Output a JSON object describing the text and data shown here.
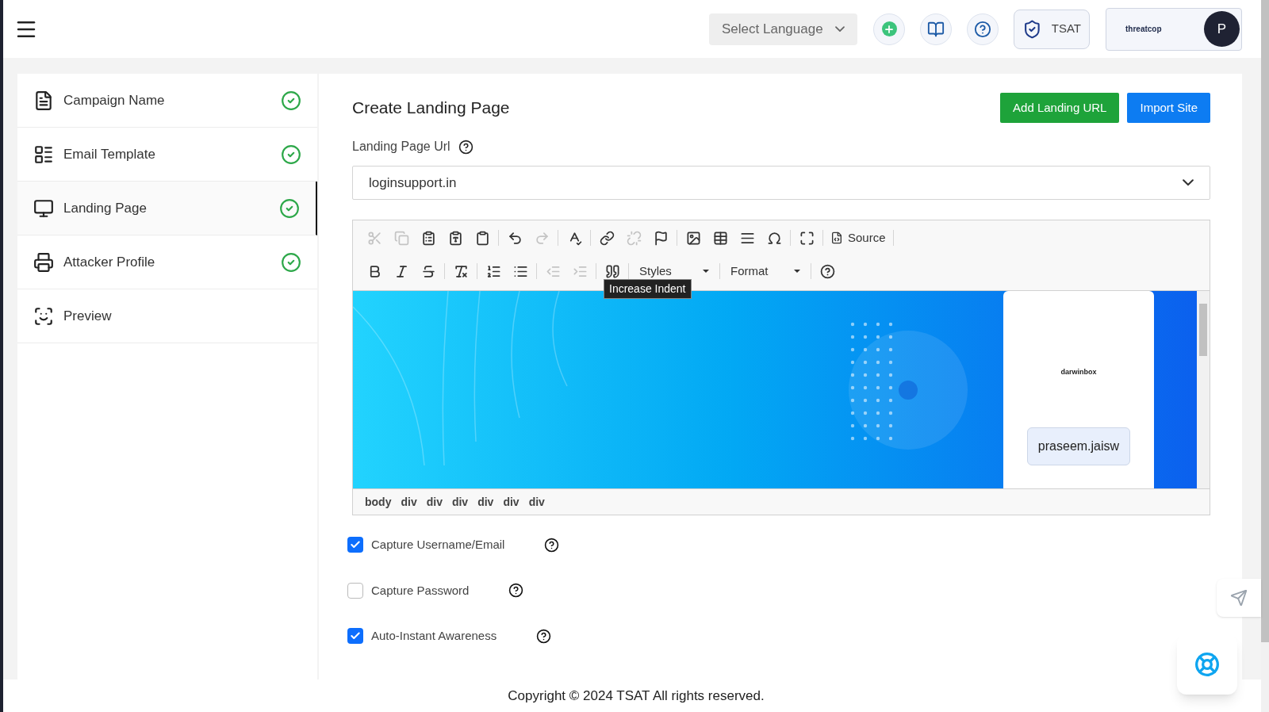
{
  "header": {
    "language_select": {
      "placeholder": "Select Language"
    },
    "brand": "TSAT",
    "org_logo": "threatcop",
    "avatar": "P"
  },
  "sidebar": {
    "items": [
      {
        "label": "Campaign Name",
        "kind": "document",
        "done": true,
        "selected": false
      },
      {
        "label": "Email Template",
        "kind": "template",
        "done": true,
        "selected": false
      },
      {
        "label": "Landing Page",
        "kind": "screen",
        "done": true,
        "selected": true
      },
      {
        "label": "Attacker Profile",
        "kind": "printer",
        "done": true,
        "selected": false
      },
      {
        "label": "Preview",
        "kind": "scan",
        "done": false,
        "selected": false
      }
    ]
  },
  "main": {
    "title": "Create Landing Page",
    "buttons": [
      {
        "label": "Add Landing URL",
        "kind": "green"
      },
      {
        "label": "Import Site",
        "kind": "blue"
      }
    ],
    "url_label": "Landing Page Url",
    "url_value": "loginsupport.in",
    "editor": {
      "toolbar_rows": [
        [
          {
            "kind": "cut",
            "disabled": true
          },
          {
            "kind": "copy",
            "disabled": true
          },
          {
            "kind": "paste",
            "disabled": false
          },
          {
            "kind": "paste-text",
            "disabled": false
          },
          {
            "kind": "paste-word",
            "disabled": false
          },
          {
            "kind": "sep"
          },
          {
            "kind": "undo",
            "disabled": false
          },
          {
            "kind": "redo",
            "disabled": true
          },
          {
            "kind": "sep"
          },
          {
            "kind": "spellcheck",
            "disabled": false
          },
          {
            "kind": "sep"
          },
          {
            "kind": "link",
            "disabled": false
          },
          {
            "kind": "unlink",
            "disabled": true
          },
          {
            "kind": "anchor",
            "disabled": false
          },
          {
            "kind": "sep"
          },
          {
            "kind": "image",
            "disabled": false
          },
          {
            "kind": "table",
            "disabled": false
          },
          {
            "kind": "hr",
            "disabled": false
          },
          {
            "kind": "special-char",
            "disabled": false
          },
          {
            "kind": "sep"
          },
          {
            "kind": "maximize",
            "disabled": false
          },
          {
            "kind": "sep"
          },
          {
            "kind": "source",
            "label": "Source",
            "disabled": false
          },
          {
            "kind": "sep"
          }
        ],
        [
          {
            "kind": "bold",
            "disabled": false
          },
          {
            "kind": "italic",
            "disabled": false
          },
          {
            "kind": "strike",
            "disabled": false
          },
          {
            "kind": "sep"
          },
          {
            "kind": "remove-format",
            "disabled": false
          },
          {
            "kind": "sep"
          },
          {
            "kind": "numbered-list",
            "disabled": false
          },
          {
            "kind": "bulleted-list",
            "disabled": false
          },
          {
            "kind": "sep"
          },
          {
            "kind": "outdent",
            "disabled": true
          },
          {
            "kind": "indent",
            "disabled": true
          },
          {
            "kind": "sep"
          },
          {
            "kind": "blockquote",
            "disabled": false
          },
          {
            "kind": "sep"
          },
          {
            "kind": "dropdown",
            "label": "Styles",
            "disabled": false
          },
          {
            "kind": "sep"
          },
          {
            "kind": "dropdown",
            "label": "Format",
            "disabled": false
          },
          {
            "kind": "sep"
          },
          {
            "kind": "help",
            "disabled": false
          }
        ]
      ],
      "tooltip": "Increase Indent",
      "preview": {
        "logo": "darwinbox",
        "username": "praseem.jaisw"
      },
      "path": [
        "body",
        "div",
        "div",
        "div",
        "div",
        "div",
        "div"
      ]
    },
    "options": [
      {
        "label": "Capture Username/Email",
        "checked": true
      },
      {
        "label": "Capture Password",
        "checked": false
      },
      {
        "label": "Auto-Instant Awareness",
        "checked": true
      }
    ]
  },
  "footer": "Copyright © 2024 TSAT All rights reserved."
}
